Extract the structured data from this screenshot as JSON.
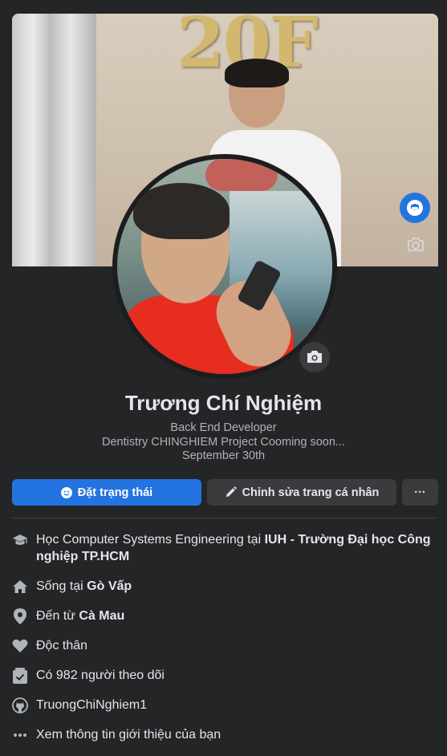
{
  "cover": {
    "sign_text": "20F"
  },
  "profile": {
    "name": "Trương Chí Nghiệm",
    "bio_line1": "Back End Developer",
    "bio_line2": "Dentistry CHINGHIEM Project Cooming soon...",
    "bio_line3": "September 30th"
  },
  "actions": {
    "status_label": "Đặt trạng thái",
    "edit_label": "Chỉnh sửa trang cá nhân",
    "more_label": "···"
  },
  "intro": {
    "education_prefix": "Học Computer Systems Engineering tại ",
    "education_school": "IUH - Trường Đại học Công nghiệp TP.HCM",
    "lives_prefix": "Sống tại ",
    "lives_place": "Gò Vấp",
    "from_prefix": "Đến từ ",
    "from_place": "Cà Mau",
    "relationship": "Độc thân",
    "followers": "Có 982 người theo dõi",
    "github": "TruongChiNghiem1",
    "see_more": "Xem thông tin giới thiệu của bạn"
  },
  "icons": {
    "messenger": "messenger-icon",
    "cover_camera": "camera-icon",
    "avatar_camera": "camera-icon",
    "status": "smile-icon",
    "edit": "pencil-icon",
    "education": "graduation-cap-icon",
    "home": "home-icon",
    "location": "map-pin-icon",
    "heart": "heart-icon",
    "followers": "inbox-check-icon",
    "github": "github-icon",
    "more": "ellipsis-icon"
  },
  "colors": {
    "background": "#242526",
    "primary": "#2374e1",
    "secondary_button": "#3a3b3c",
    "text": "#e4e6eb",
    "muted_text": "#b0b3b8"
  }
}
